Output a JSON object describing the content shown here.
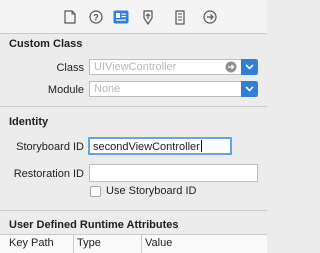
{
  "toolbar": {
    "icons": [
      "file-icon",
      "help-icon",
      "identity-icon",
      "attributes-icon",
      "size-icon",
      "connections-icon"
    ],
    "active": "identity-icon"
  },
  "custom_class": {
    "title": "Custom Class",
    "class_label": "Class",
    "class_placeholder": "UIViewController",
    "module_label": "Module",
    "module_placeholder": "None"
  },
  "identity": {
    "title": "Identity",
    "storyboard_id_label": "Storyboard ID",
    "storyboard_id_value": "secondViewController",
    "restoration_id_label": "Restoration ID",
    "restoration_id_value": "",
    "use_storyboard_id_label": "Use Storyboard ID"
  },
  "runtime_attributes": {
    "title": "User Defined Runtime Attributes",
    "columns": [
      "Key Path",
      "Type",
      "Value"
    ]
  },
  "colors": {
    "accent": "#2f7fd9",
    "background": "#ececec"
  }
}
